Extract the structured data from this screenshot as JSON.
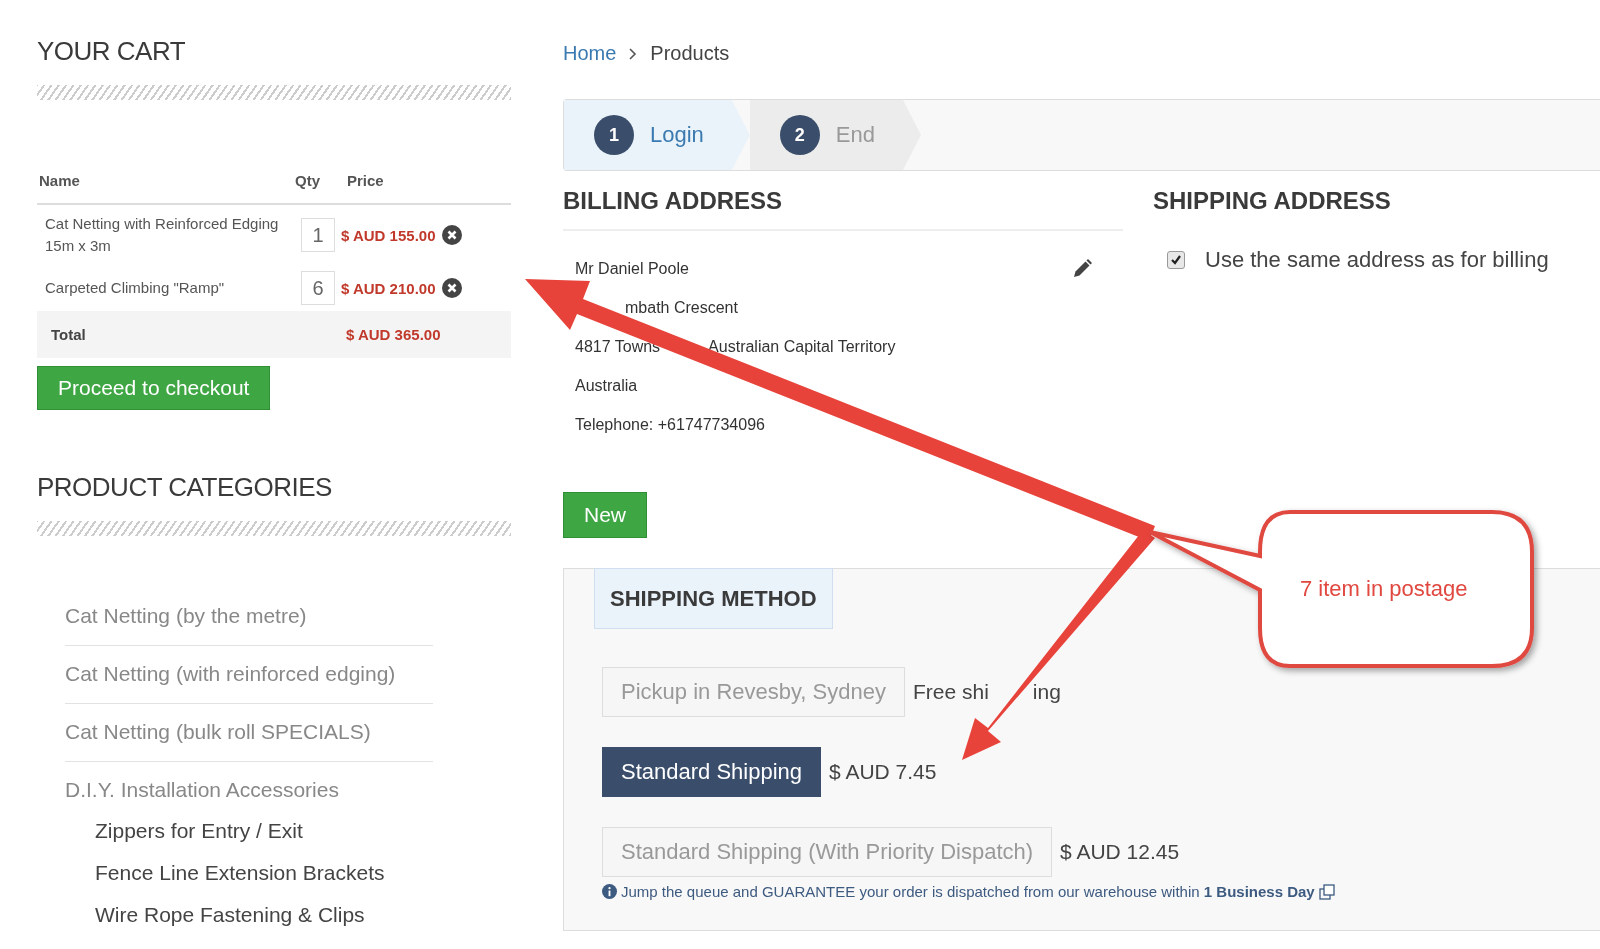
{
  "cart": {
    "title": "YOUR CART",
    "columns": [
      "Name",
      "Qty",
      "Price"
    ],
    "items": [
      {
        "name": "Cat Netting with Reinforced Edging 15m x 3m",
        "qty": "1",
        "price": "$ AUD 155.00"
      },
      {
        "name": "Carpeted Climbing \"Ramp\"",
        "qty": "6",
        "price": "$ AUD 210.00"
      }
    ],
    "total_label": "Total",
    "total": "$ AUD 365.00",
    "checkout_button": "Proceed to checkout"
  },
  "categories": {
    "title": "PRODUCT CATEGORIES",
    "items": [
      {
        "label": "Cat Netting (by the metre)"
      },
      {
        "label": "Cat Netting (with reinforced edging)"
      },
      {
        "label": "Cat Netting (bulk roll SPECIALS)"
      },
      {
        "label": "D.I.Y. Installation Accessories",
        "children": [
          {
            "label": "Zippers for Entry / Exit"
          },
          {
            "label": "Fence Line Extension Brackets"
          },
          {
            "label": "Wire Rope Fastening & Clips"
          }
        ]
      }
    ]
  },
  "breadcrumb": [
    "Home",
    "Products"
  ],
  "steps": [
    {
      "number": "1",
      "label": "Login",
      "selected": true
    },
    {
      "number": "2",
      "label": "End",
      "selected": false
    }
  ],
  "billing": {
    "title": "BILLING ADDRESS",
    "lines": [
      {
        "segments": [
          "Mr Daniel Poole"
        ]
      },
      {
        "segments": [
          "mbath Crescent"
        ],
        "covered_start": true
      },
      {
        "segments": [
          "4817 Towns",
          "Australian Capital Territory"
        ]
      },
      {
        "segments": [
          "Australia"
        ]
      },
      {
        "segments": [
          "Telephone: +61747734096"
        ]
      }
    ]
  },
  "shipping_address": {
    "title": "SHIPPING ADDRESS",
    "same_as_billing": {
      "label": "Use the same address as for billing",
      "checked": true
    }
  },
  "new_button": "New",
  "shipping_method": {
    "title": "SHIPPING METHOD",
    "options": [
      {
        "label": "Pickup in Revesby, Sydney",
        "price": [
          "Free shi",
          "ing"
        ],
        "selected": false
      },
      {
        "label": "Standard Shipping",
        "price": [
          "$ AUD 7.45"
        ],
        "selected": true
      },
      {
        "label": "Standard Shipping (With Priority Dispatch)",
        "price": [
          "$ AUD 12.45"
        ],
        "selected": false
      }
    ],
    "note": "Jump the queue and GUARANTEE your order is dispatched from our warehouse within **1 Business Day**"
  },
  "annotation": {
    "text": "7 item in postage"
  }
}
